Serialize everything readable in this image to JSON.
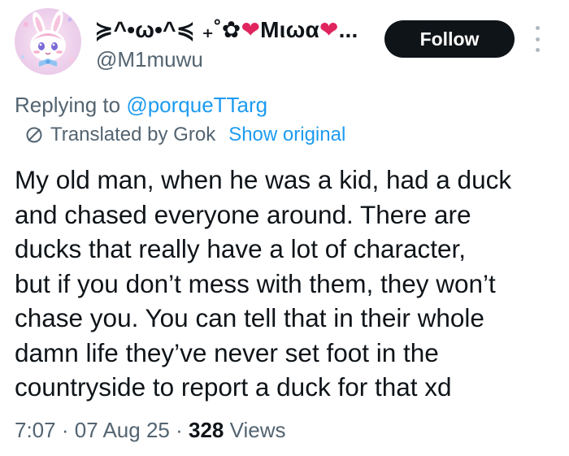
{
  "author": {
    "display_name_prefix": "≽^•ω•^≼ ₊˚✿",
    "display_name_name": "Mιωα",
    "display_name_suffix": "...",
    "handle": "@M1muwu",
    "avatar_icon": "anime-bunny-avatar"
  },
  "actions": {
    "follow_label": "Follow",
    "more_icon": "more-vertical-icon"
  },
  "reply": {
    "prefix": "Replying to",
    "mention": "@porqueTTarg"
  },
  "translation": {
    "icon": "slash-circle-icon",
    "label": "Translated by Grok",
    "show_original": "Show original"
  },
  "tweet": {
    "lines": [
      "My old man, when he was a kid, had a duck",
      "and chased everyone around. There are",
      "ducks that really have a lot of character,",
      "but if you don’t mess with them, they won’t",
      "chase you. You can tell that in their whole",
      "damn life they’ve never set foot in the",
      "countryside to report a duck for that xd"
    ]
  },
  "meta": {
    "time": "7:07",
    "date": "07 Aug 25",
    "separator": "·",
    "views_count": "328",
    "views_label": "Views"
  },
  "colors": {
    "link_blue": "#1d9bf0",
    "secondary_text": "#536471",
    "primary_text": "#0f1419",
    "heart": "#e0245e"
  }
}
